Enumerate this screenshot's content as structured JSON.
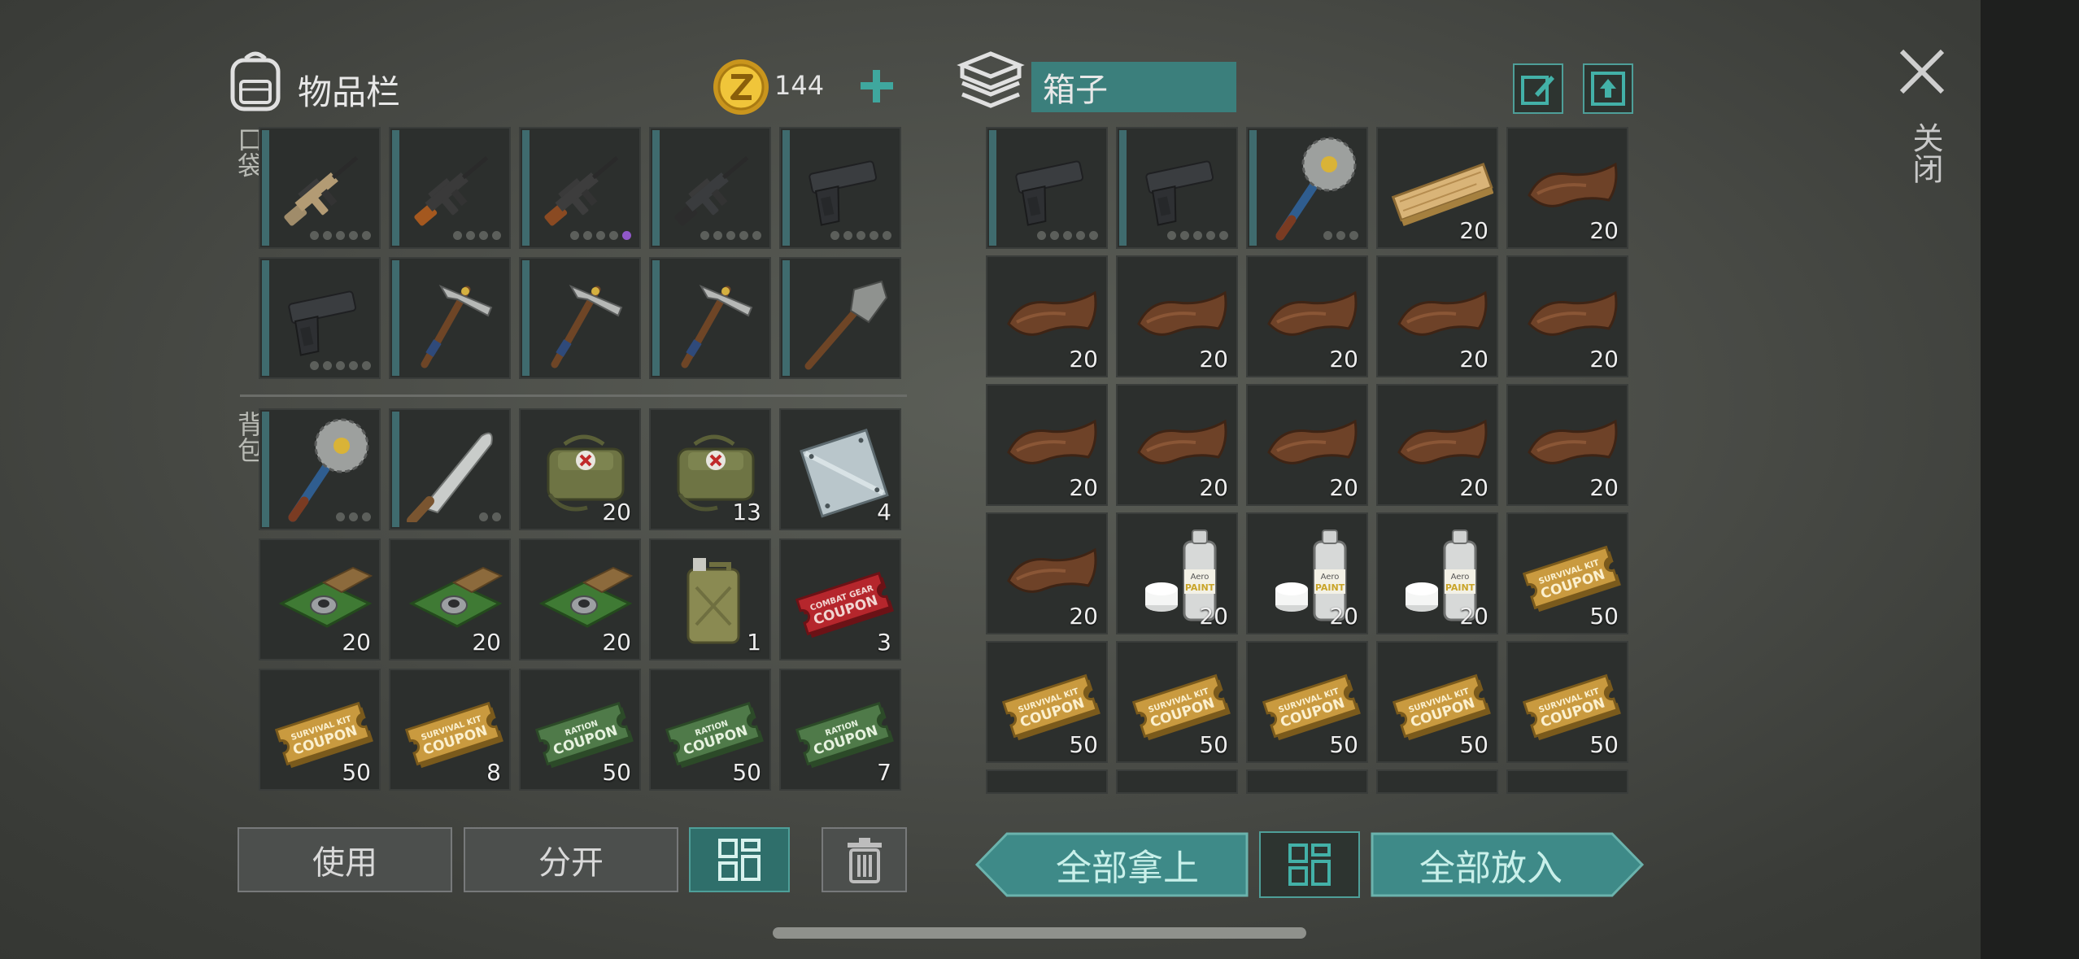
{
  "inventory": {
    "title": "物品栏",
    "currency_amount": "144",
    "pockets_label": "口袋",
    "backpack_label": "背包",
    "pockets": [
      {
        "icon": "assault-rifle-icon",
        "durability": 5,
        "purple": false
      },
      {
        "icon": "sniper-rifle-icon",
        "durability": 4,
        "purple": false
      },
      {
        "icon": "ak-rifle-icon",
        "durability": 5,
        "purple": true
      },
      {
        "icon": "m16-rifle-icon",
        "durability": 5,
        "purple": false
      },
      {
        "icon": "pistol-icon",
        "durability": 5,
        "purple": false
      },
      {
        "icon": "pistol-icon",
        "durability": 5,
        "purple": false
      },
      {
        "icon": "pickaxe-icon",
        "durability": 0,
        "purple": false
      },
      {
        "icon": "pickaxe-icon",
        "durability": 0,
        "purple": false
      },
      {
        "icon": "pickaxe-icon",
        "durability": 0,
        "purple": false
      },
      {
        "icon": "shovel-icon",
        "durability": 0,
        "purple": false
      }
    ],
    "backpack": [
      {
        "icon": "saw-mace-icon",
        "count": "",
        "durability": 3
      },
      {
        "icon": "machete-icon",
        "count": "",
        "durability": 2
      },
      {
        "icon": "medkit-bag-icon",
        "count": "20",
        "durability": 0
      },
      {
        "icon": "medkit-bag-icon",
        "count": "13",
        "durability": 0
      },
      {
        "icon": "metal-plate-icon",
        "count": "4",
        "durability": 0
      },
      {
        "icon": "circuit-board-icon",
        "count": "20",
        "durability": 0
      },
      {
        "icon": "circuit-board-icon",
        "count": "20",
        "durability": 0
      },
      {
        "icon": "circuit-board-icon",
        "count": "20",
        "durability": 0
      },
      {
        "icon": "jerrycan-icon",
        "count": "1",
        "durability": 0
      },
      {
        "icon": "combat-gear-coupon-icon",
        "count": "3",
        "durability": 0
      },
      {
        "icon": "survival-kit-coupon-icon",
        "count": "50",
        "durability": 0
      },
      {
        "icon": "survival-kit-coupon-icon",
        "count": "8",
        "durability": 0
      },
      {
        "icon": "ration-coupon-icon",
        "count": "50",
        "durability": 0
      },
      {
        "icon": "ration-coupon-icon",
        "count": "50",
        "durability": 0
      },
      {
        "icon": "ration-coupon-icon",
        "count": "7",
        "durability": 0
      }
    ],
    "buttons": {
      "use": "使用",
      "split": "分开"
    }
  },
  "box": {
    "name": "箱子",
    "items": [
      {
        "icon": "pistol-icon",
        "count": "",
        "durability": 5
      },
      {
        "icon": "pistol-icon",
        "count": "",
        "durability": 5
      },
      {
        "icon": "saw-mace-icon",
        "count": "",
        "durability": 3
      },
      {
        "icon": "wood-plank-icon",
        "count": "20",
        "durability": 0
      },
      {
        "icon": "leather-icon",
        "count": "20",
        "durability": 0
      },
      {
        "icon": "leather-icon",
        "count": "20",
        "durability": 0
      },
      {
        "icon": "leather-icon",
        "count": "20",
        "durability": 0
      },
      {
        "icon": "leather-icon",
        "count": "20",
        "durability": 0
      },
      {
        "icon": "leather-icon",
        "count": "20",
        "durability": 0
      },
      {
        "icon": "leather-icon",
        "count": "20",
        "durability": 0
      },
      {
        "icon": "leather-icon",
        "count": "20",
        "durability": 0
      },
      {
        "icon": "leather-icon",
        "count": "20",
        "durability": 0
      },
      {
        "icon": "leather-icon",
        "count": "20",
        "durability": 0
      },
      {
        "icon": "leather-icon",
        "count": "20",
        "durability": 0
      },
      {
        "icon": "leather-icon",
        "count": "20",
        "durability": 0
      },
      {
        "icon": "leather-icon",
        "count": "20",
        "durability": 0
      },
      {
        "icon": "spray-paint-icon",
        "count": "20",
        "durability": 0
      },
      {
        "icon": "spray-paint-icon",
        "count": "20",
        "durability": 0
      },
      {
        "icon": "spray-paint-icon",
        "count": "20",
        "durability": 0
      },
      {
        "icon": "survival-kit-coupon-icon",
        "count": "50",
        "durability": 0
      },
      {
        "icon": "survival-kit-coupon-icon",
        "count": "50",
        "durability": 0
      },
      {
        "icon": "survival-kit-coupon-icon",
        "count": "50",
        "durability": 0
      },
      {
        "icon": "survival-kit-coupon-icon",
        "count": "50",
        "durability": 0
      },
      {
        "icon": "survival-kit-coupon-icon",
        "count": "50",
        "durability": 0
      },
      {
        "icon": "survival-kit-coupon-icon",
        "count": "50",
        "durability": 0
      }
    ],
    "buttons": {
      "take_all": "全部拿上",
      "put_all": "全部放入"
    }
  },
  "close_label": "关闭",
  "item_art_text": {
    "survival_kit": [
      "SURVIVAL KIT",
      "COUPON"
    ],
    "ration": [
      "RATION",
      "COUPON"
    ],
    "combat_gear": [
      "COMBAT GEAR",
      "COUPON"
    ],
    "spray": [
      "Aero",
      "PAINT"
    ]
  },
  "colors": {
    "accent": "#3e8a88",
    "slot_bg": "#2c2f2d",
    "coin": "#e3b52c",
    "leather": "#6e4228"
  }
}
